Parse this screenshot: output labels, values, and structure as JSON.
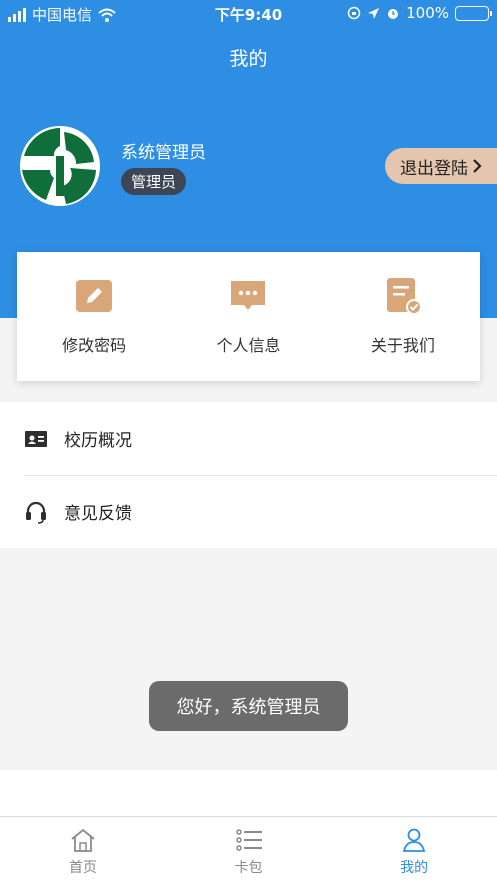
{
  "status_bar": {
    "carrier": "中国电信",
    "time": "下午9:40",
    "battery": "100%"
  },
  "header": {
    "title": "我的"
  },
  "profile": {
    "name": "系统管理员",
    "role": "管理员",
    "logout_label": "退出登陆"
  },
  "quick_actions": [
    {
      "label": "修改密码",
      "icon": "edit-icon"
    },
    {
      "label": "个人信息",
      "icon": "chat-icon"
    },
    {
      "label": "关于我们",
      "icon": "document-check-icon"
    }
  ],
  "menu": [
    {
      "label": "校历概况",
      "icon": "id-card-icon"
    },
    {
      "label": "意见反馈",
      "icon": "headset-icon"
    }
  ],
  "toast": "您好，系统管理员",
  "tabs": [
    {
      "label": "首页",
      "icon": "home-icon"
    },
    {
      "label": "卡包",
      "icon": "list-icon"
    },
    {
      "label": "我的",
      "icon": "user-icon",
      "active": true
    }
  ],
  "colors": {
    "primary": "#2d8ee3",
    "accent": "#e3c6ad",
    "icon_tan": "#d9a679",
    "logo_green": "#0f6e3a"
  }
}
